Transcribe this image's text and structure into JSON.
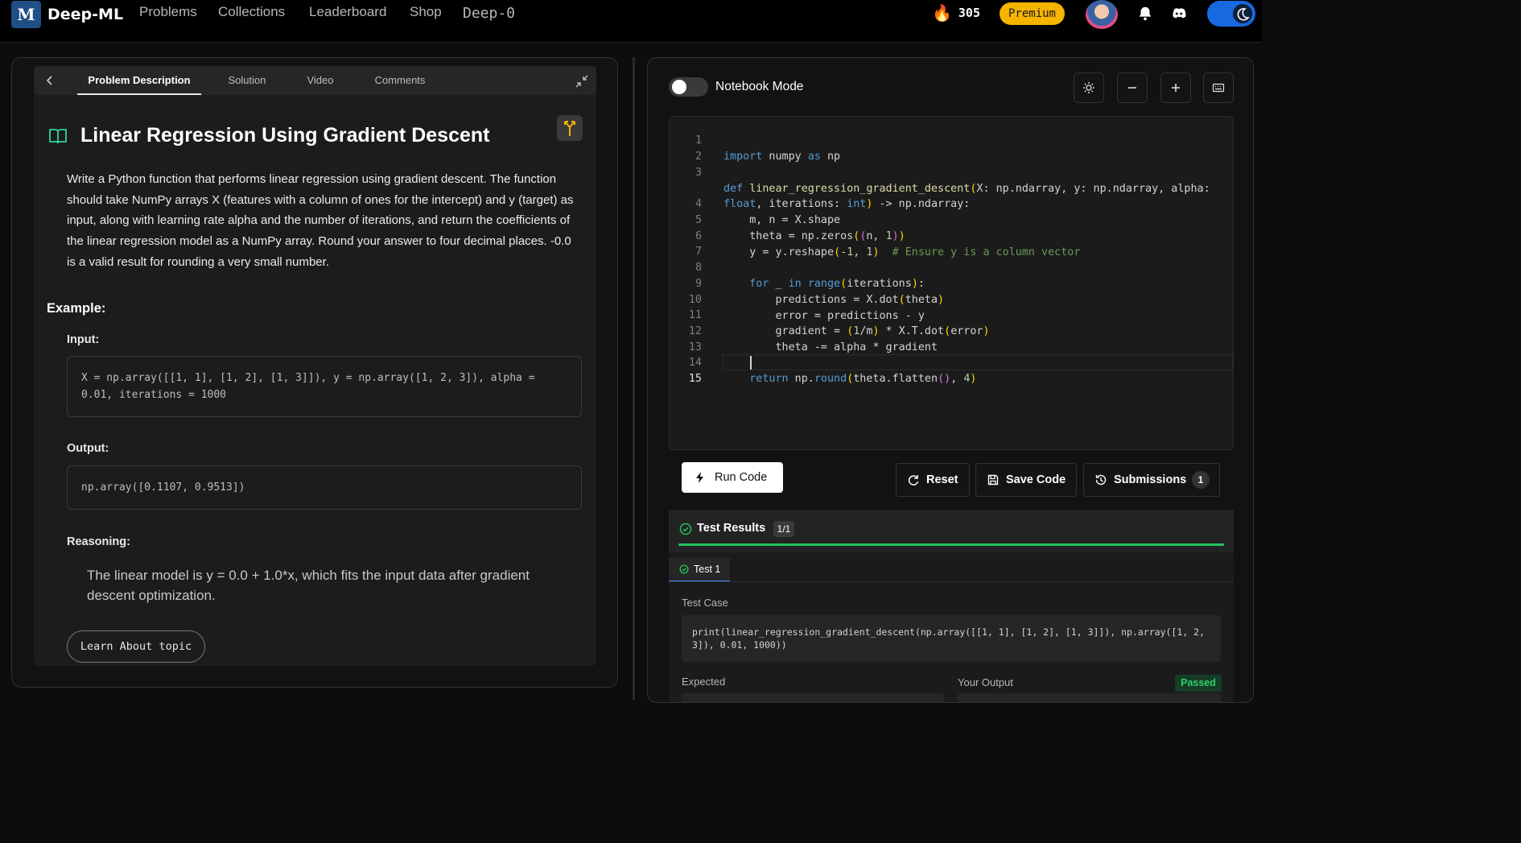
{
  "nav": {
    "logo_text": "M",
    "brand": "Deep-ML",
    "links": [
      "Problems",
      "Collections",
      "Leaderboard",
      "Shop",
      "Deep-0"
    ],
    "streak": "305",
    "premium": "Premium"
  },
  "problem": {
    "tabs": [
      "Problem Description",
      "Solution",
      "Video",
      "Comments"
    ],
    "title": "Linear Regression Using Gradient Descent",
    "description": "Write a Python function that performs linear regression using gradient descent. The function should take NumPy arrays X (features with a column of ones for the intercept) and y (target) as input, along with learning rate alpha and the number of iterations, and return the coefficients of the linear regression model as a NumPy array. Round your answer to four decimal places. -0.0 is a valid result for rounding a very small number.",
    "example_heading": "Example:",
    "input_label": "Input:",
    "input_value": "X = np.array([[1, 1], [1, 2], [1, 3]]), y = np.array([1, 2, 3]), alpha = 0.01, iterations = 1000",
    "output_label": "Output:",
    "output_value": "np.array([0.1107, 0.9513])",
    "reasoning_label": "Reasoning:",
    "reasoning_text": "The linear model is y = 0.0 + 1.0*x, which fits the input data after gradient descent optimization.",
    "learn_button": "Learn About topic"
  },
  "editor": {
    "notebook_mode_label": "Notebook Mode",
    "notebook_mode_on": false,
    "line_numbers": [
      "1",
      "2",
      "3",
      "",
      "4",
      "5",
      "6",
      "7",
      "8",
      "9",
      "10",
      "11",
      "12",
      "13",
      "14",
      "15"
    ],
    "code_lines": [
      "import numpy as np",
      "",
      "def linear_regression_gradient_descent(X: np.ndarray, y: np.ndarray, alpha:",
      "float, iterations: int) -> np.ndarray:",
      "    m, n = X.shape",
      "    theta = np.zeros((n, 1))",
      "    y = y.reshape(-1, 1)  # Ensure y is a column vector",
      "",
      "    for _ in range(iterations):",
      "        predictions = X.dot(theta)",
      "        error = predictions - y",
      "        gradient = (1/m) * X.T.dot(error)",
      "        theta -= alpha * gradient",
      "",
      "    return np.round(theta.flatten(), 4)",
      ""
    ]
  },
  "actions": {
    "run": "Run Code",
    "reset": "Reset",
    "save": "Save Code",
    "submissions": "Submissions",
    "submissions_count": "1"
  },
  "results": {
    "title": "Test Results",
    "count": "1/1",
    "progress_fraction": 1.0,
    "test_tab": "Test 1",
    "test_case_label": "Test Case",
    "test_case_code": "print(linear_regression_gradient_descent(np.array([[1, 1], [1, 2], [1, 3]]), np.array([1, 2, 3]), 0.01, 1000))",
    "expected_label": "Expected",
    "your_output_label": "Your Output",
    "status": "Passed"
  },
  "colors": {
    "accent_green": "#22c55e",
    "premium_yellow": "#f5b400",
    "theme_blue": "#1769e0"
  }
}
